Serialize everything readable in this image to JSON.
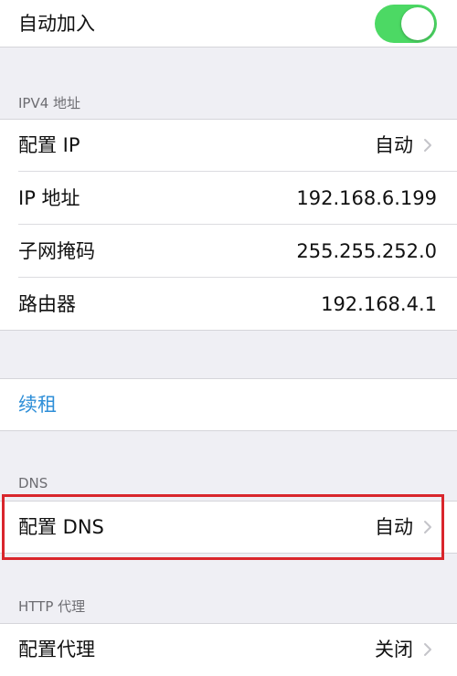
{
  "auto_join": {
    "label": "自动加入",
    "toggle_on": true,
    "toggle_color": "#4cd964"
  },
  "ipv4": {
    "header": "IPV4 地址",
    "rows": [
      {
        "label": "配置 IP",
        "value": "自动",
        "disclosure": true
      },
      {
        "label": "IP 地址",
        "value": "192.168.6.199"
      },
      {
        "label": "子网掩码",
        "value": "255.255.252.0"
      },
      {
        "label": "路由器",
        "value": "192.168.4.1"
      }
    ]
  },
  "renew": {
    "label": "续租",
    "color": "#2f8fd8"
  },
  "dns": {
    "header": "DNS",
    "configure": {
      "label": "配置 DNS",
      "value": "自动"
    },
    "highlight_color": "#d9262c"
  },
  "http_proxy": {
    "header": "HTTP 代理",
    "configure": {
      "label": "配置代理",
      "value": "关闭"
    }
  },
  "icons": {
    "disclosure": "chevron-right-icon"
  }
}
